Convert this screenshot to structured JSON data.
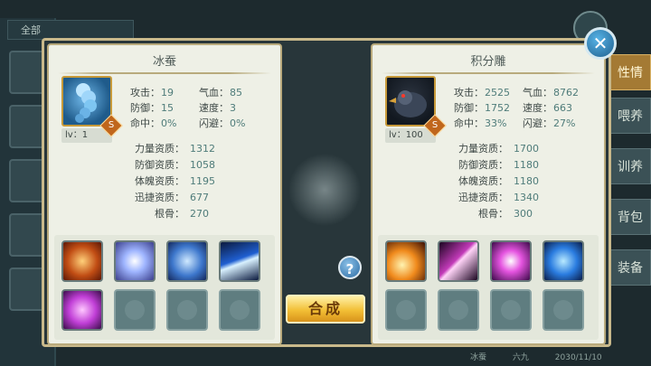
{
  "background": {
    "top_tab": "全部",
    "side_tabs": [
      "性情",
      "喂养",
      "训养",
      "背包",
      "装备"
    ],
    "bottom_text": [
      "冰蚕",
      "六九",
      "2030/11/10"
    ]
  },
  "left_pet": {
    "name": "冰蚕",
    "level_label": "lv：1",
    "grade": "S",
    "stats": [
      {
        "k": "攻击：",
        "v": "19",
        "k2": "气血：",
        "v2": "85"
      },
      {
        "k": "防御：",
        "v": "15",
        "k2": "速度：",
        "v2": "3"
      },
      {
        "k": "命中：",
        "v": "0%",
        "k2": "闪避：",
        "v2": "0%"
      }
    ],
    "aptitudes": [
      {
        "k": "力量资质：",
        "v": "1312"
      },
      {
        "k": "防御资质：",
        "v": "1058"
      },
      {
        "k": "体魄资质：",
        "v": "1195"
      },
      {
        "k": "迅捷资质：",
        "v": "677"
      },
      {
        "k": "根骨：",
        "v": "270"
      }
    ]
  },
  "right_pet": {
    "name": "积分雕",
    "level_label": "lv：100",
    "grade": "S",
    "stats": [
      {
        "k": "攻击：",
        "v": "2525",
        "k2": "气血：",
        "v2": "8762"
      },
      {
        "k": "防御：",
        "v": "1752",
        "k2": "速度：",
        "v2": "663"
      },
      {
        "k": "命中：",
        "v": "33%",
        "k2": "闪避：",
        "v2": "27%"
      }
    ],
    "aptitudes": [
      {
        "k": "力量资质：",
        "v": "1700"
      },
      {
        "k": "防御资质：",
        "v": "1180"
      },
      {
        "k": "体魄资质：",
        "v": "1180"
      },
      {
        "k": "迅捷资质：",
        "v": "1340"
      },
      {
        "k": "根骨：",
        "v": "300"
      }
    ]
  },
  "center": {
    "help_label": "?",
    "combine_label": "合成",
    "close_label": "✕"
  }
}
